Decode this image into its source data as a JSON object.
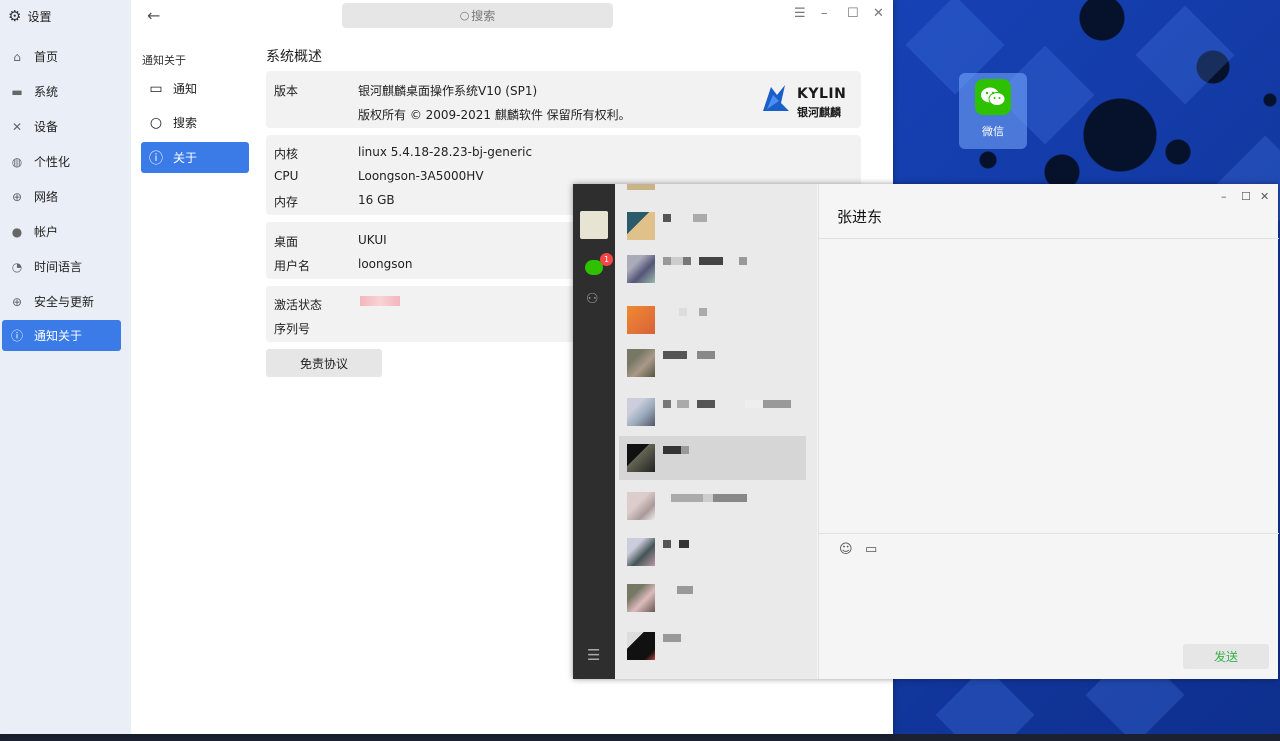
{
  "desktop": {
    "app_label": "微信"
  },
  "settings": {
    "app_title": "设置",
    "search_placeholder": "搜索",
    "sidebar": [
      {
        "label": "首页",
        "icon": "home-icon"
      },
      {
        "label": "系统",
        "icon": "monitor-icon"
      },
      {
        "label": "设备",
        "icon": "tools-icon"
      },
      {
        "label": "个性化",
        "icon": "palette-icon"
      },
      {
        "label": "网络",
        "icon": "globe-icon"
      },
      {
        "label": "帐户",
        "icon": "user-icon"
      },
      {
        "label": "时间语言",
        "icon": "clock-icon"
      },
      {
        "label": "安全与更新",
        "icon": "shield-icon"
      },
      {
        "label": "通知关于",
        "icon": "info-icon",
        "active": true
      }
    ],
    "sub_header": "通知关于",
    "sub_items": [
      {
        "label": "通知",
        "icon": "message-icon"
      },
      {
        "label": "搜索",
        "icon": "search-icon"
      },
      {
        "label": "关于",
        "icon": "info-icon",
        "active": true
      }
    ],
    "section_title": "系统概述",
    "version_label": "版本",
    "version_value": "银河麒麟桌面操作系统V10 (SP1)",
    "copyright": "版权所有 © 2009-2021 麒麟软件 保留所有权利。",
    "logo_text": "KYLIN",
    "logo_sub": "银河麒麟",
    "kernel_label": "内核",
    "kernel_value": "linux 5.4.18-28.23-bj-generic",
    "cpu_label": "CPU",
    "cpu_value": "Loongson-3A5000HV",
    "memory_label": "内存",
    "memory_value": "16 GB",
    "desktop_label": "桌面",
    "desktop_value": "UKUI",
    "username_label": "用户名",
    "username_value": "loongson",
    "activation_label": "激活状态",
    "serial_label": "序列号",
    "disclaimer_button": "免责协议"
  },
  "wechat": {
    "badge_count": "1",
    "chat_title": "张进东",
    "send_button": "发送"
  }
}
